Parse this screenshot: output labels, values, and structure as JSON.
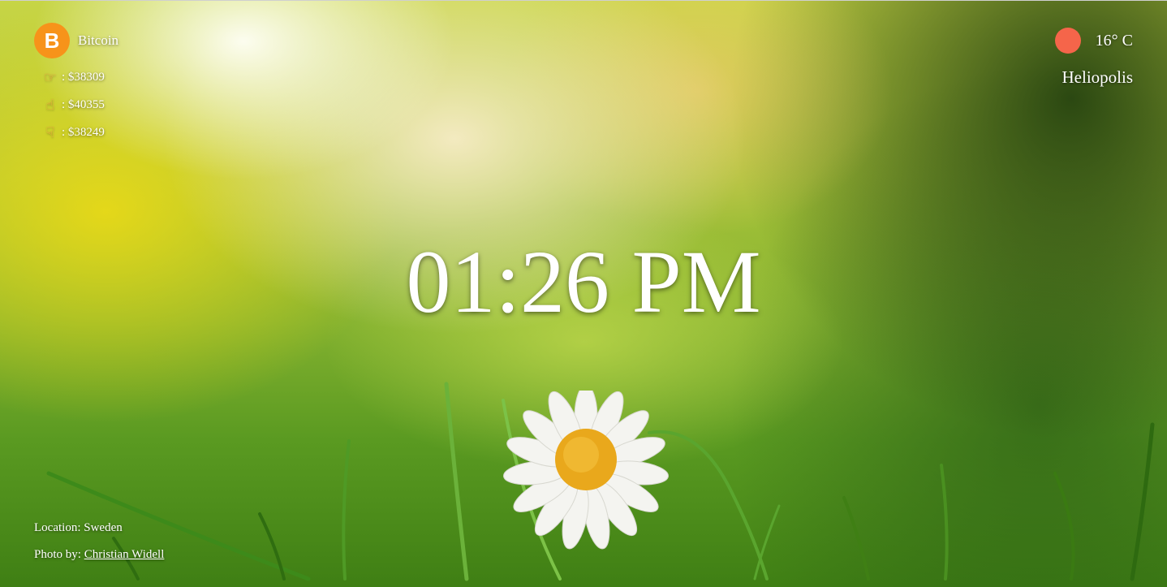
{
  "crypto": {
    "name": "Bitcoin",
    "icon": "bitcoin-icon",
    "icon_symbol": "B",
    "current": {
      "icon": "hand-pointing-right-icon",
      "value": ": $38309"
    },
    "high": {
      "icon": "hand-pointing-up-icon",
      "value": ": $40355"
    },
    "low": {
      "icon": "hand-pointing-down-icon",
      "value": ": $38249"
    }
  },
  "weather": {
    "icon": "weather-sun-icon",
    "icon_color": "#f5654a",
    "temperature": "16° C",
    "city": "Heliopolis"
  },
  "clock": {
    "time": "01:26 PM"
  },
  "credits": {
    "location": "Location: Sweden",
    "photo_prefix": "Photo by: ",
    "photographer": "Christian Widell"
  },
  "colors": {
    "bitcoin": "#f7931a",
    "text": "#ffffff"
  }
}
